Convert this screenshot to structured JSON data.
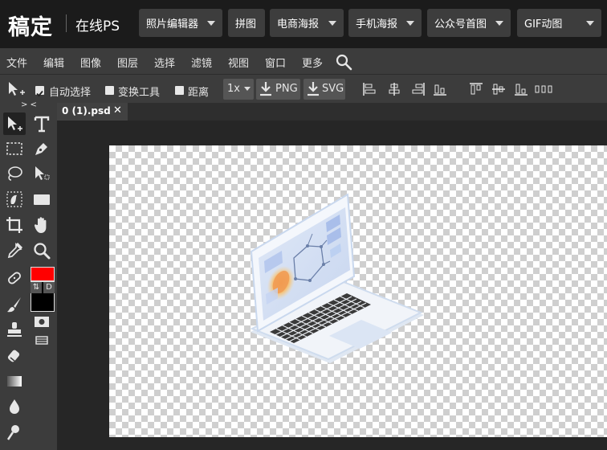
{
  "app": {
    "logo": "稿定",
    "subtitle": "在线PS"
  },
  "nav": {
    "items": [
      {
        "label": "照片编辑器"
      },
      {
        "label": "拼图"
      },
      {
        "label": "电商海报"
      },
      {
        "label": "手机海报"
      },
      {
        "label": "公众号首图"
      },
      {
        "label": "GIF动图"
      }
    ]
  },
  "menu": {
    "items": [
      "文件",
      "编辑",
      "图像",
      "图层",
      "选择",
      "滤镜",
      "视图",
      "窗口",
      "更多"
    ]
  },
  "options": {
    "auto_select": "自动选择",
    "transform_tools": "变换工具",
    "distance": "距离",
    "zoom": "1x",
    "png": "PNG",
    "svg": "SVG",
    "collapse": "> <"
  },
  "document": {
    "tab_title": "0 (1).psd",
    "close": "✕"
  },
  "colors": {
    "foreground": "#ff0000",
    "background": "#000000",
    "swap_label": "⇅",
    "default_label": "D"
  }
}
